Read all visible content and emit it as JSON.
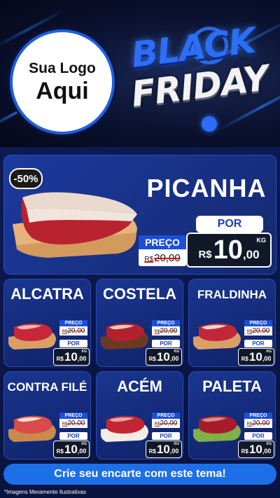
{
  "header": {
    "logo_line1": "Sua Logo",
    "logo_line2": "Aqui",
    "campaign_word1": "BLACK",
    "campaign_word2": "FRIDAY"
  },
  "featured": {
    "discount": "-50%",
    "name": "PICANHA",
    "por_label": "POR",
    "preco_label": "PREÇO",
    "old_currency": "R$",
    "old_price": "20,00",
    "currency": "R$",
    "price_int": "10",
    "price_dec": ",00",
    "unit": "KG"
  },
  "products": [
    {
      "name": "ALCATRA",
      "preco_label": "PREÇO",
      "old_currency": "R$",
      "old_price": "20,00",
      "por_label": "POR",
      "currency": "R$",
      "price_int": "10",
      "price_dec": ",00",
      "unit": "KG"
    },
    {
      "name": "COSTELA",
      "preco_label": "PREÇO",
      "old_currency": "R$",
      "old_price": "20,00",
      "por_label": "POR",
      "currency": "R$",
      "price_int": "10",
      "price_dec": ",00",
      "unit": "KG"
    },
    {
      "name": "FRALDINHA",
      "preco_label": "PREÇO",
      "old_currency": "R$",
      "old_price": "20,00",
      "por_label": "POR",
      "currency": "R$",
      "price_int": "10",
      "price_dec": ",00",
      "unit": "KG"
    },
    {
      "name": "CONTRA FILÉ",
      "preco_label": "PREÇO",
      "old_currency": "R$",
      "old_price": "20,00",
      "por_label": "POR",
      "currency": "R$",
      "price_int": "10",
      "price_dec": ",00",
      "unit": "KG"
    },
    {
      "name": "ACÉM",
      "preco_label": "PREÇO",
      "old_currency": "R$",
      "old_price": "20,00",
      "por_label": "POR",
      "currency": "R$",
      "price_int": "10",
      "price_dec": ",00",
      "unit": "KG"
    },
    {
      "name": "PALETA",
      "preco_label": "PREÇO",
      "old_currency": "R$",
      "old_price": "20,00",
      "por_label": "POR",
      "currency": "R$",
      "price_int": "10",
      "price_dec": ",00",
      "unit": "KG"
    }
  ],
  "cta": "Crie seu encarte com este tema!",
  "disclaimer": "*Imagens Meramente Ilustrativas",
  "colors": {
    "accent": "#1d6fe8",
    "background": "#0a1440",
    "strike": "#e01010"
  }
}
